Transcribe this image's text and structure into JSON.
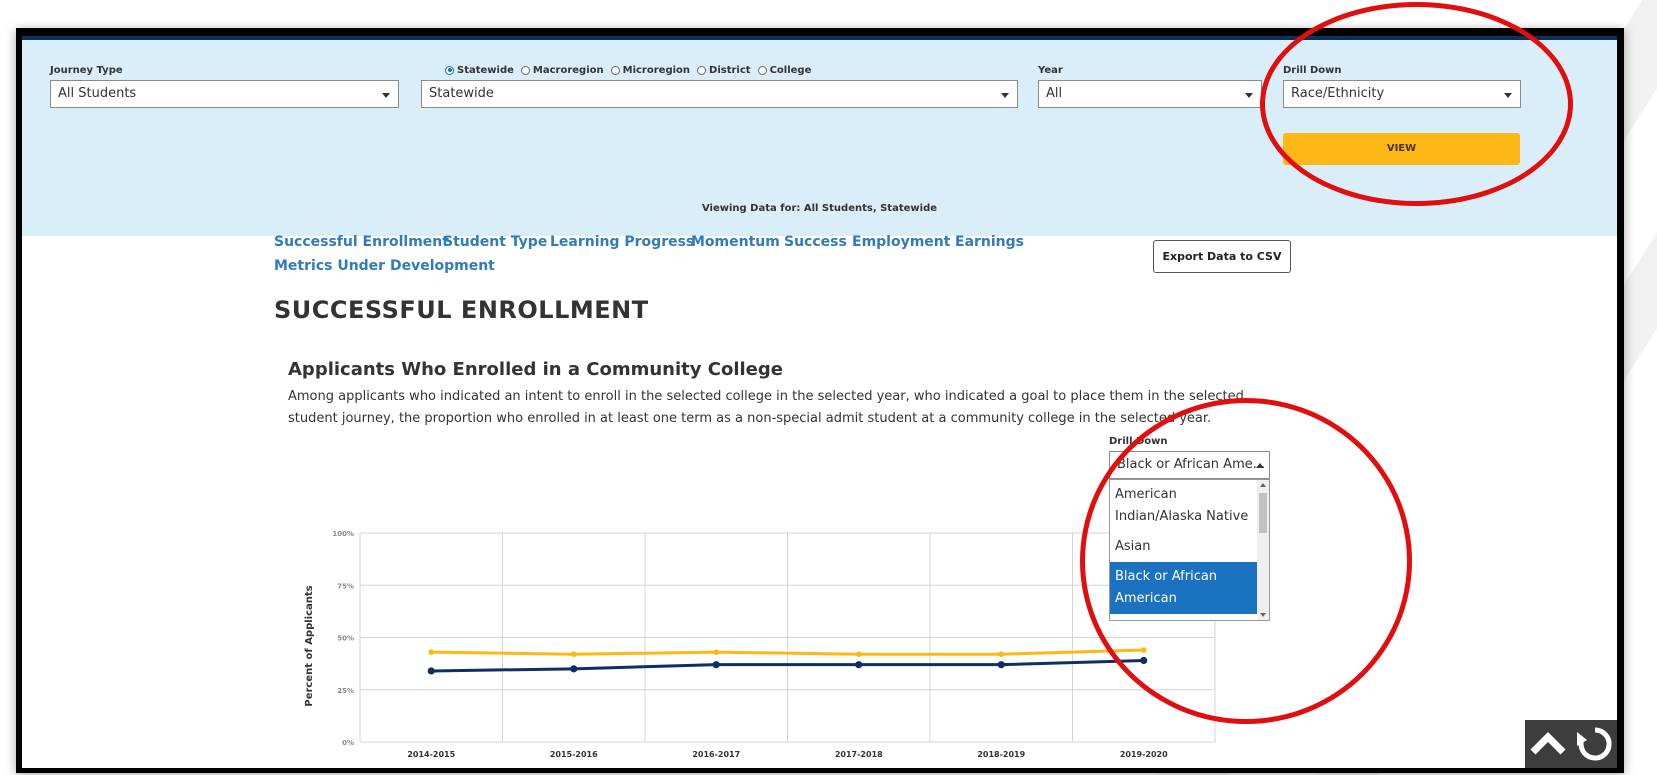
{
  "filters": {
    "journey_type": {
      "label": "Journey Type",
      "value": "All Students"
    },
    "geography": {
      "radios": [
        {
          "label": "Statewide",
          "checked": true
        },
        {
          "label": "Macroregion",
          "checked": false
        },
        {
          "label": "Microregion",
          "checked": false
        },
        {
          "label": "District",
          "checked": false
        },
        {
          "label": "College",
          "checked": false
        }
      ],
      "value": "Statewide"
    },
    "year": {
      "label": "Year",
      "value": "All"
    },
    "drill_down": {
      "label": "Drill Down",
      "value": "Race/Ethnicity"
    },
    "view_button": "VIEW",
    "viewing_text": "Viewing Data for: All Students, Statewide"
  },
  "nav": {
    "links": [
      "Successful Enrollment",
      "Student Type",
      "Learning Progress",
      "Momentum",
      "Success",
      "Employment",
      "Earnings",
      "Metrics Under Development"
    ],
    "export_button": "Export Data to CSV"
  },
  "section_title": "SUCCESSFUL ENROLLMENT",
  "chart_title": "Applicants Who Enrolled in a Community College",
  "chart_description": "Among applicants who indicated an intent to enroll in the selected college in the selected year, who indicated a goal to place them in the selected student journey, the proportion who enrolled in at least one term as a non-special admit student at a community college in the selected year.",
  "chart_drill_down": {
    "label": "Drill Down",
    "value": "Black or African Ame...",
    "options": [
      "American Indian/Alaska Native",
      "Asian",
      "Black or African American"
    ],
    "selected_index": 2
  },
  "colors": {
    "header_bg": "#d9eef8",
    "top_band": "#0c2f5e",
    "view_button": "#fcb815",
    "link": "#2f7bbd",
    "series_gold": "#fcb815",
    "series_navy": "#0d2f63",
    "annotation": "#e20d0d"
  },
  "chart_data": {
    "type": "line",
    "ylabel": "Percent of Applicants",
    "xlabel": "",
    "categories": [
      "2014-2015",
      "2015-2016",
      "2016-2017",
      "2017-2018",
      "2018-2019",
      "2019-2020"
    ],
    "yticks": [
      "100%",
      "75%",
      "50%",
      "25%",
      "0%"
    ],
    "ylim": [
      0,
      100
    ],
    "series": [
      {
        "color": "#fcb815",
        "values": [
          43,
          42,
          43,
          42,
          42,
          44
        ]
      },
      {
        "color": "#0d2f63",
        "values": [
          34,
          35,
          37,
          37,
          37,
          39
        ]
      }
    ],
    "grid": true
  },
  "icons": {
    "scroll_top": "chevron-up-icon",
    "refresh": "refresh-icon"
  }
}
